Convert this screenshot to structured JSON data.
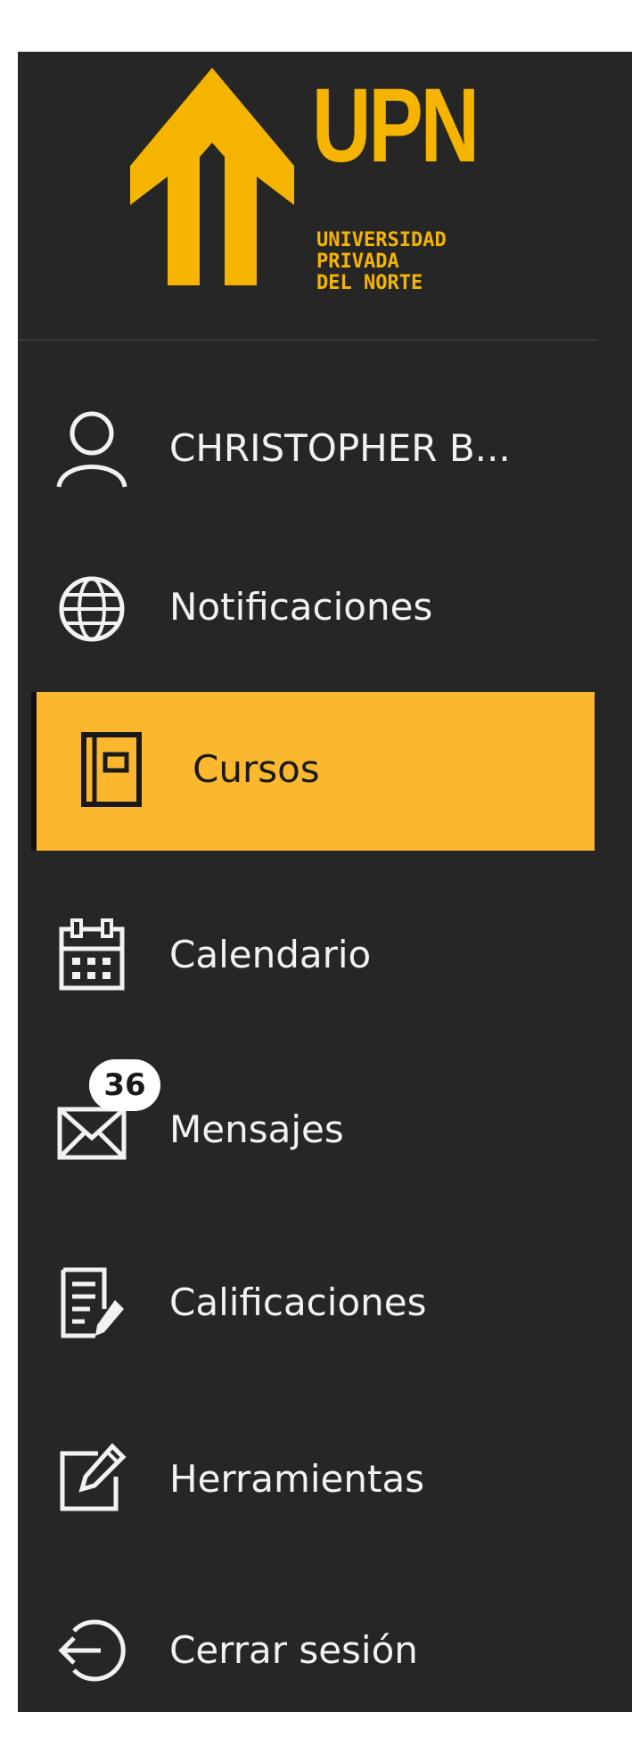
{
  "brand": {
    "name": "UPN",
    "line1": "UNIVERSIDAD",
    "line2": "PRIVADA",
    "line3": "DEL NORTE",
    "color": "#f5b400"
  },
  "nav": {
    "user": {
      "label": "CHRISTOPHER B...",
      "icon": "user-icon"
    },
    "notifications": {
      "label": "Notificaciones",
      "icon": "globe-icon"
    },
    "courses": {
      "label": "Cursos",
      "icon": "book-icon",
      "active": true
    },
    "calendar": {
      "label": "Calendario",
      "icon": "calendar-icon"
    },
    "messages": {
      "label": "Mensajes",
      "icon": "envelope-icon",
      "badge": "36"
    },
    "grades": {
      "label": "Calificaciones",
      "icon": "grades-icon"
    },
    "tools": {
      "label": "Herramientas",
      "icon": "edit-icon"
    },
    "logout": {
      "label": "Cerrar sesión",
      "icon": "logout-icon"
    }
  },
  "colors": {
    "sidebar_bg": "#262626",
    "active_bg": "#fbb72d",
    "text": "#f2f2f2"
  }
}
